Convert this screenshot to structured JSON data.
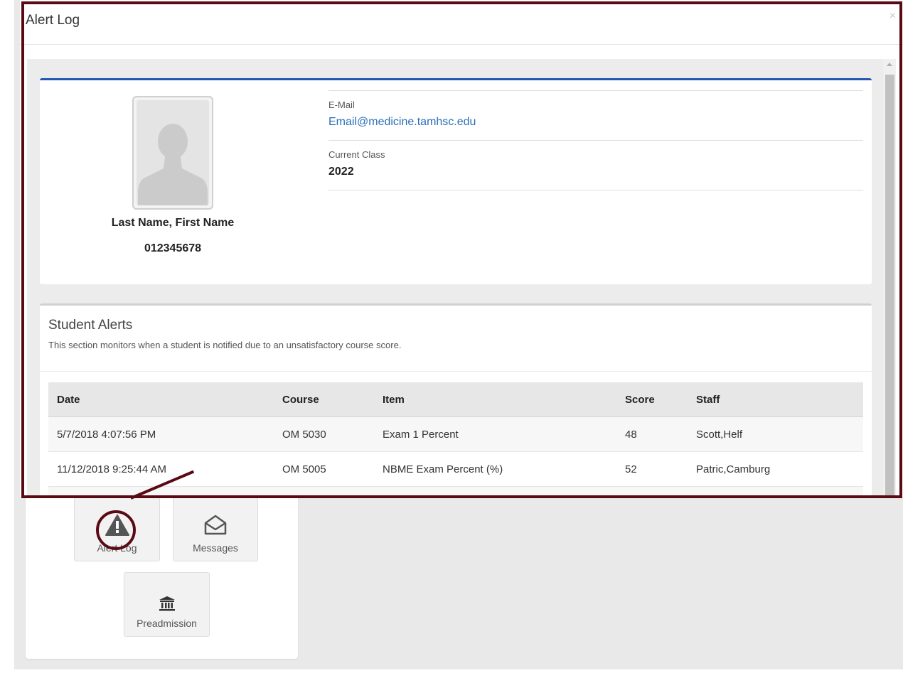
{
  "modal": {
    "title": "Alert Log",
    "close_icon": "×"
  },
  "profile": {
    "name": "Last Name, First Name",
    "student_id": "012345678",
    "email_label": "E-Mail",
    "email_value": "Email@medicine.tamhsc.edu",
    "class_label": "Current Class",
    "class_value": "2022"
  },
  "alerts": {
    "title": "Student Alerts",
    "subtitle": "This section monitors when a student is notified due to an unsatisfactory course score.",
    "columns": [
      "Date",
      "Course",
      "Item",
      "Score",
      "Staff"
    ],
    "rows": [
      {
        "date": "5/7/2018 4:07:56 PM",
        "course": "OM 5030",
        "item": "Exam 1 Percent",
        "score": "48",
        "staff": "Scott,Helf"
      },
      {
        "date": "11/12/2018 9:25:44 AM",
        "course": "OM 5005",
        "item": "NBME Exam Percent (%)",
        "score": "52",
        "staff": "Patric,Camburg"
      }
    ]
  },
  "tiles": {
    "alert_log": {
      "label": "Alert Log",
      "icon": "warning-icon"
    },
    "messages": {
      "label": "Messages",
      "icon": "envelope-open-icon"
    },
    "preadmission": {
      "label": "Preadmission",
      "icon": "institution-icon"
    }
  },
  "colors": {
    "accent": "#2457b3",
    "link": "#2a6fb8",
    "annotation": "#5a0a14"
  }
}
